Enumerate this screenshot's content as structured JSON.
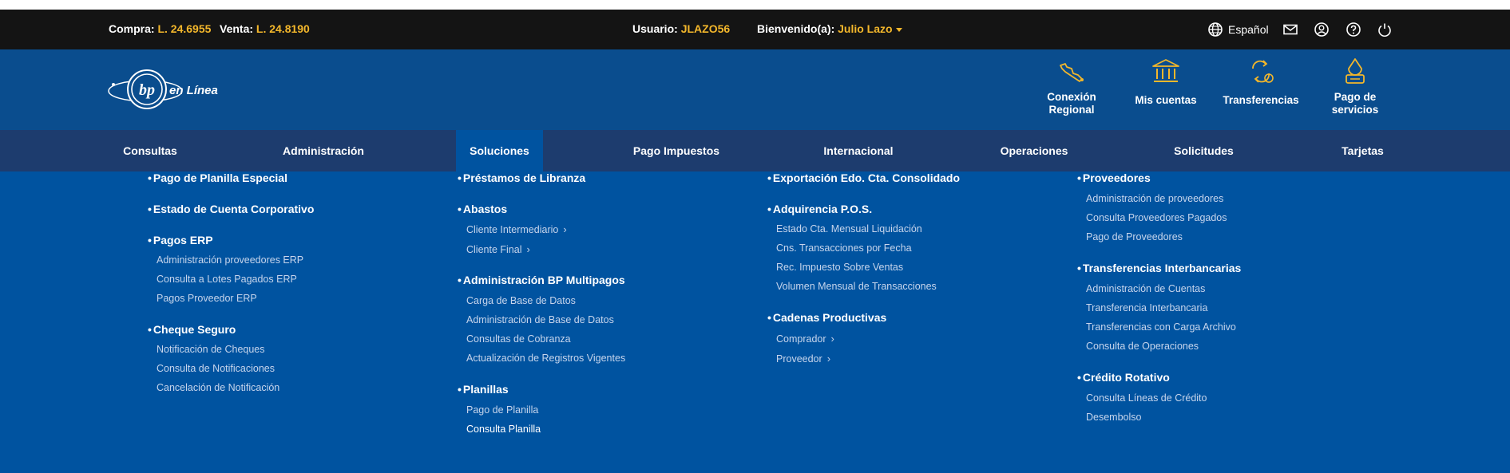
{
  "topbar": {
    "buy_label": "Compra:",
    "buy_value": "L. 24.6955",
    "sell_label": "Venta:",
    "sell_value": "L. 24.8190",
    "user_label": "Usuario:",
    "user_value": "JLAZO56",
    "welcome_label": "Bienvenido(a):",
    "welcome_name": "Julio Lazo",
    "language": "Español"
  },
  "logo": {
    "text": "en Línea",
    "mark": "bp"
  },
  "quick_links": [
    {
      "label_line1": "Conexión",
      "label_line2": "Regional",
      "icon": "connection-icon"
    },
    {
      "label_line1": "Mis cuentas",
      "label_line2": "",
      "icon": "bank-icon"
    },
    {
      "label_line1": "Transferencias",
      "label_line2": "",
      "icon": "transfer-icon"
    },
    {
      "label_line1": "Pago de",
      "label_line2": "servicios",
      "icon": "payment-hand-icon"
    }
  ],
  "nav": {
    "items": [
      "Consultas",
      "Administración",
      "Soluciones",
      "Pago Impuestos",
      "Internacional",
      "Operaciones",
      "Solicitudes",
      "Tarjetas"
    ],
    "active": "Soluciones"
  },
  "menu": {
    "col1": {
      "s1": "Pago de Planilla Especial",
      "s2": "Estado de Cuenta Corporativo",
      "s3": "Pagos ERP",
      "s3_items": [
        "Administración proveedores ERP",
        "Consulta a Lotes Pagados ERP",
        "Pagos Proveedor ERP"
      ],
      "s4": "Cheque Seguro",
      "s4_items": [
        "Notificación de Cheques",
        "Consulta de Notificaciones",
        "Cancelación de Notificación"
      ]
    },
    "col2": {
      "s1": "Préstamos de Libranza",
      "s2": "Abastos",
      "s2_items": [
        "Cliente Intermediario",
        "Cliente Final"
      ],
      "s3": "Administración BP Multipagos",
      "s3_items": [
        "Carga de Base de Datos",
        "Administración de Base de Datos",
        "Consultas de Cobranza",
        "Actualización de Registros Vigentes"
      ],
      "s4": "Planillas",
      "s4_items": [
        "Pago de Planilla",
        "Consulta Planilla"
      ]
    },
    "col3": {
      "s1": "Exportación Edo. Cta. Consolidado",
      "s2": "Adquirencia P.O.S.",
      "s2_items": [
        "Estado Cta. Mensual Liquidación",
        "Cns. Transacciones por Fecha",
        "Rec. Impuesto Sobre Ventas",
        "Volumen Mensual de Transacciones"
      ],
      "s3": "Cadenas Productivas",
      "s3_items": [
        "Comprador",
        "Proveedor"
      ]
    },
    "col4": {
      "s1": "Proveedores",
      "s1_items": [
        "Administración de proveedores",
        "Consulta Proveedores Pagados",
        "Pago de Proveedores"
      ],
      "s2": "Transferencias Interbancarias",
      "s2_items": [
        "Administración de Cuentas",
        "Transferencia Interbancaria",
        "Transferencias con Carga Archivo",
        "Consulta de Operaciones"
      ],
      "s3": "Crédito Rotativo",
      "s3_items": [
        "Consulta Líneas de Crédito",
        "Desembolso"
      ]
    }
  },
  "colors": {
    "topbar_bg": "#141414",
    "header_bg": "#0a4d8e",
    "nav_bg": "#1d3c6e",
    "menu_bg": "#0053a0",
    "accent_yellow": "#f3b72b"
  }
}
